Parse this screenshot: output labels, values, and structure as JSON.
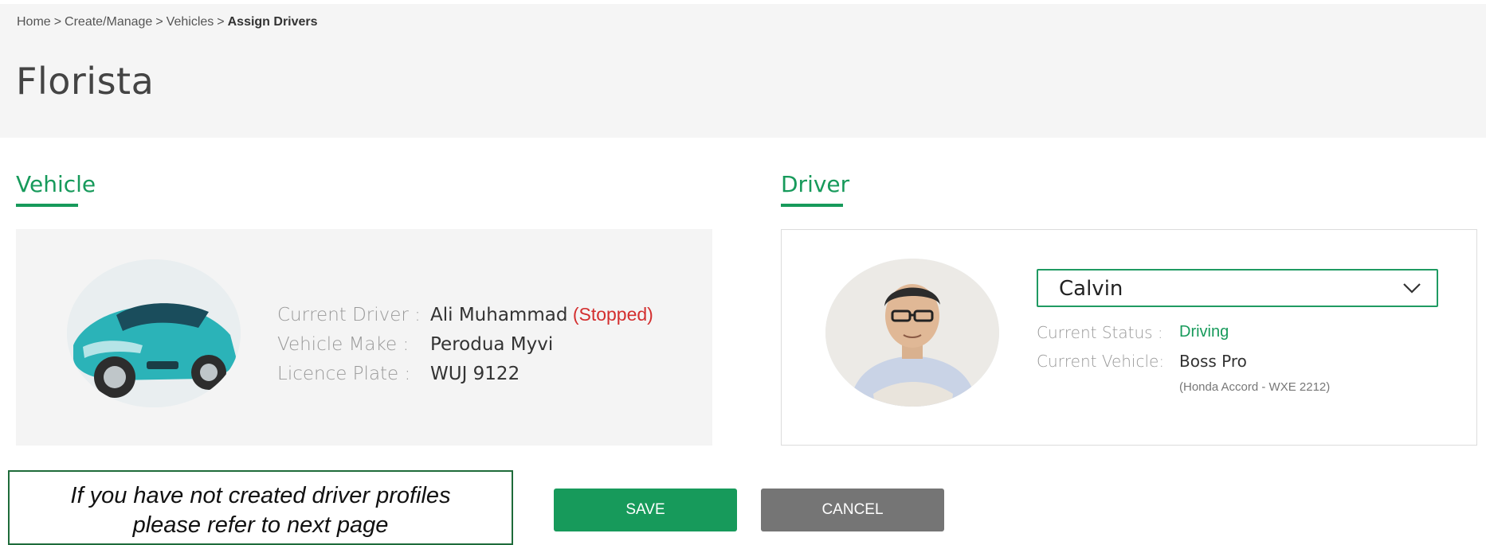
{
  "breadcrumb": {
    "items": [
      "Home",
      "Create/Manage",
      "Vehicles"
    ],
    "current": "Assign Drivers",
    "separator": ">"
  },
  "page": {
    "title": "Florista"
  },
  "vehicle": {
    "section_title": "Vehicle",
    "current_driver_label": "Current Driver :",
    "current_driver_value": "Ali Muhammad",
    "current_driver_status": "(Stopped)",
    "make_label": "Vehicle Make :",
    "make_value": "Perodua Myvi",
    "plate_label": "Licence Plate :",
    "plate_value": "WUJ 9122"
  },
  "driver": {
    "section_title": "Driver",
    "selected": "Calvin",
    "status_label": "Current Status :",
    "status_value": "Driving",
    "vehicle_label": "Current Vehicle:",
    "vehicle_value": "Boss Pro",
    "vehicle_detail": "(Honda Accord - WXE 2212)"
  },
  "actions": {
    "save_label": "SAVE",
    "cancel_label": "CANCEL"
  },
  "note": {
    "line1": "If you have not created driver profiles",
    "line2": "please refer to next page"
  },
  "colors": {
    "accent": "#179a5b",
    "stopped": "#d32f2f",
    "cancel": "#757575"
  }
}
